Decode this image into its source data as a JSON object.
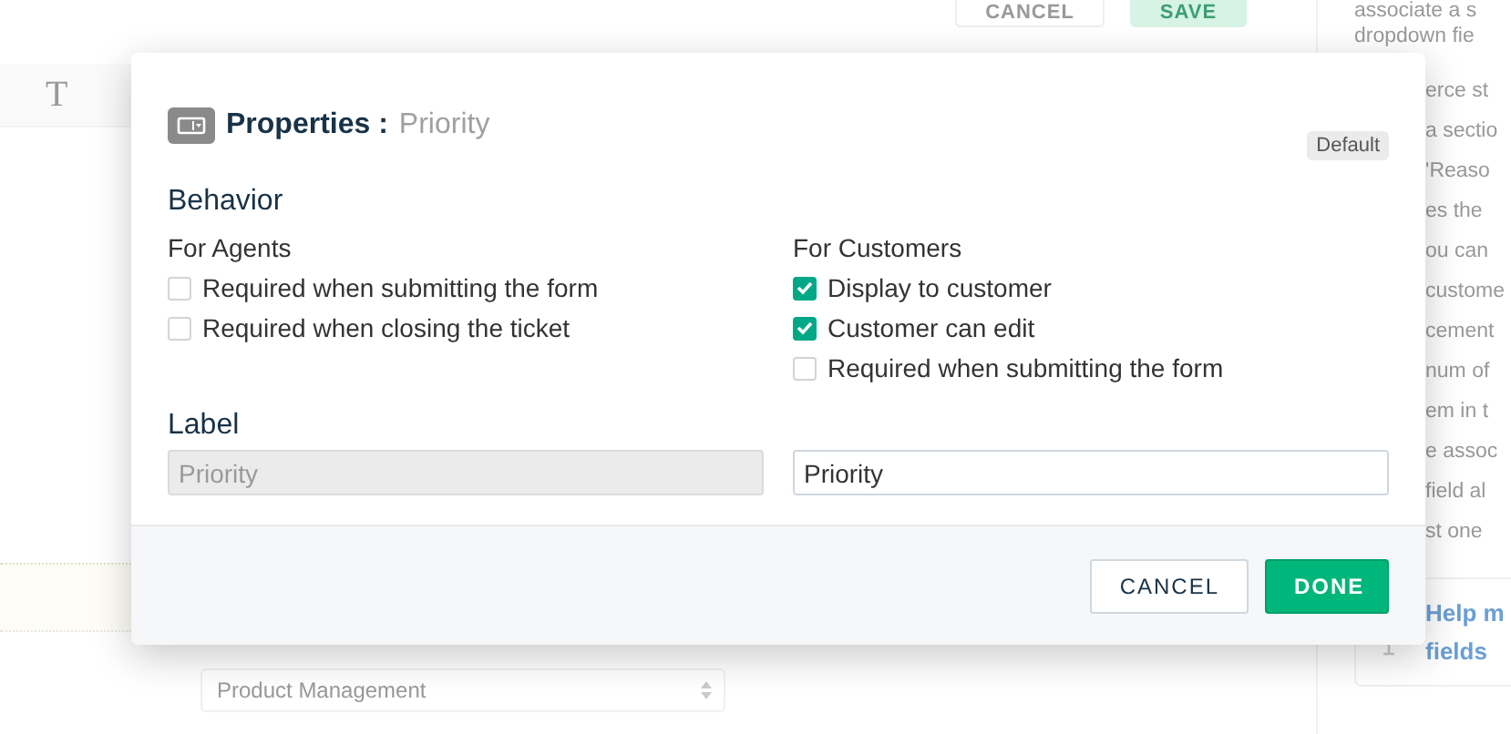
{
  "background": {
    "top_buttons": [
      {
        "label": "CANCEL",
        "kind": "outline"
      },
      {
        "label": "SAVE",
        "kind": "primary"
      }
    ],
    "toolbar_glyph": "T",
    "help_lines": [
      "associate a s",
      "dropdown fie",
      "erce st",
      "a sectio",
      "'Reaso",
      "es the",
      "ou can",
      "custome",
      "cement",
      "num of",
      "em in t",
      "e assoc",
      "field al",
      "st one"
    ],
    "help_card": {
      "lines": [
        "Help m",
        "fields"
      ]
    },
    "select": {
      "value": "Product Management"
    }
  },
  "dialog": {
    "title": "Properties :",
    "subtitle": "Priority",
    "badge": "Default",
    "behavior_heading": "Behavior",
    "columns": [
      {
        "heading": "For Agents",
        "options": [
          {
            "label": "Required when submitting the form",
            "checked": false
          },
          {
            "label": "Required when closing the ticket",
            "checked": false
          }
        ]
      },
      {
        "heading": "For Customers",
        "options": [
          {
            "label": "Display to customer",
            "checked": true
          },
          {
            "label": "Customer can edit",
            "checked": true
          },
          {
            "label": "Required when submitting the form",
            "checked": false
          }
        ]
      }
    ],
    "label_heading": "Label",
    "fields": [
      {
        "value": "Priority",
        "disabled": true
      },
      {
        "value": "Priority",
        "disabled": false
      }
    ],
    "buttons": [
      {
        "label": "CANCEL",
        "kind": "secondary"
      },
      {
        "label": "DONE",
        "kind": "primary"
      }
    ]
  }
}
